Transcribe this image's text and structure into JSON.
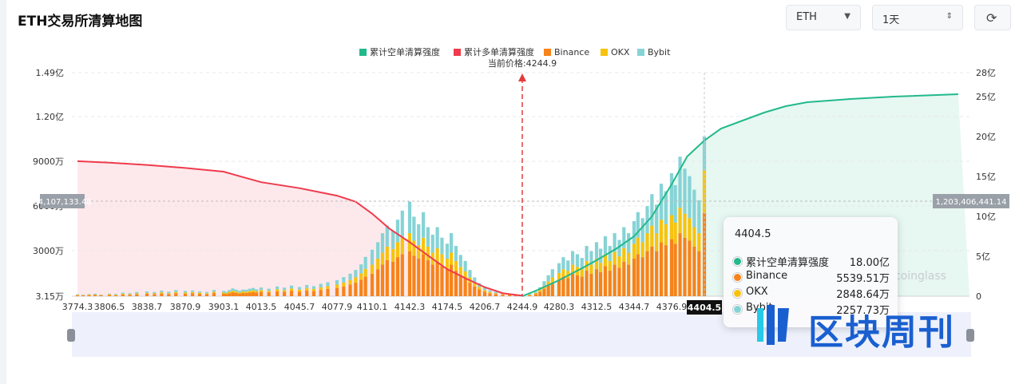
{
  "page": {
    "title": "ETH交易所清算地图",
    "coin_select": "ETH",
    "range_select": "1天",
    "refresh_icon": "refresh-icon"
  },
  "colors": {
    "short_cum": "#22b98b",
    "long_cum": "#ef3b4c",
    "binance": "#f7831a",
    "okx": "#f7c30e",
    "bybit": "#86d3d6",
    "price_marker": "#e23b3b",
    "short_area": "#e4f6ef",
    "long_area": "#fde7ea"
  },
  "chart_data": {
    "type": "bar",
    "title": "",
    "legend": [
      {
        "name": "累计空单清算强度",
        "color": "#22b98b"
      },
      {
        "name": "累计多单清算强度",
        "color": "#ef3b4c"
      },
      {
        "name": "Binance",
        "color": "#f7831a"
      },
      {
        "name": "OKX",
        "color": "#f7c30e"
      },
      {
        "name": "Bybit",
        "color": "#86d3d6"
      }
    ],
    "legend_position": "top-center",
    "current_price_label": "当前价格:4244.9",
    "current_price": 4244.9,
    "x_ticks": [
      "3774.3",
      "3806.5",
      "3838.7",
      "3870.9",
      "3903.1",
      "4013.5",
      "4045.7",
      "4077.9",
      "4110.1",
      "4142.3",
      "4174.5",
      "4206.7",
      "4244.9",
      "4280.3",
      "4312.5",
      "4344.7",
      "4376.9",
      "4404.5"
    ],
    "x_range": [
      3774.3,
      4450
    ],
    "y_left_ticks": [
      "3.15万",
      "3000万",
      "6000万",
      "9000万",
      "1.20亿",
      "1.49亿"
    ],
    "y_left_range_label": [
      "3.15万",
      "1.49亿"
    ],
    "y_right_ticks": [
      "0",
      "5亿",
      "10亿",
      "15亿",
      "20亿",
      "25亿",
      "28亿"
    ],
    "y_right_range": [
      0,
      28
    ],
    "left_axis_pointer": "64,107,133.46",
    "right_axis_pointer": "1,203,406,441.14",
    "hover_x": "4404.5",
    "long_cum_curve": {
      "name": "累计多单清算强度",
      "x": [
        3774.3,
        3806.5,
        3838.7,
        3870.9,
        3903.1,
        3950,
        4013.5,
        4045.7,
        4077.9,
        4095,
        4110.1,
        4125,
        4142.3,
        4160,
        4174.5,
        4190,
        4206.7,
        4225,
        4244.9
      ],
      "y_wan": [
        9000,
        8900,
        8750,
        8550,
        8300,
        8000,
        7600,
        7200,
        6700,
        6300,
        5500,
        4500,
        3600,
        2600,
        1800,
        1200,
        600,
        200,
        31.5
      ]
    },
    "short_cum_curve": {
      "name": "累计空单清算强度",
      "x": [
        4244.9,
        4260,
        4280.3,
        4300,
        4312.5,
        4330,
        4344.7,
        4360,
        4376.9,
        4390,
        4404.5,
        4420,
        4440,
        4460,
        4480,
        4500,
        4540,
        4580,
        4640
      ],
      "y_yi": [
        0,
        0.8,
        2,
        3.5,
        4.5,
        6,
        7.5,
        10,
        14,
        17.5,
        19.5,
        21,
        22,
        23,
        23.8,
        24.3,
        24.7,
        25,
        25.3
      ]
    },
    "bar_series": [
      {
        "name": "Binance",
        "note": "stacked bottom"
      },
      {
        "name": "OKX",
        "note": "stacked middle"
      },
      {
        "name": "Bybit",
        "note": "stacked top"
      }
    ],
    "bars": [
      [
        3774.3,
        60,
        30,
        40
      ],
      [
        3780,
        50,
        20,
        30
      ],
      [
        3786,
        70,
        40,
        30
      ],
      [
        3792,
        80,
        30,
        60
      ],
      [
        3798,
        60,
        20,
        30
      ],
      [
        3806.5,
        90,
        40,
        40
      ],
      [
        3812,
        70,
        30,
        50
      ],
      [
        3818,
        110,
        50,
        80
      ],
      [
        3824,
        100,
        40,
        60
      ],
      [
        3830,
        130,
        60,
        90
      ],
      [
        3838.7,
        160,
        60,
        100
      ],
      [
        3845,
        140,
        50,
        90
      ],
      [
        3851,
        180,
        80,
        110
      ],
      [
        3857,
        150,
        50,
        100
      ],
      [
        3863,
        200,
        80,
        130
      ],
      [
        3870.9,
        170,
        70,
        110
      ],
      [
        3877,
        190,
        90,
        100
      ],
      [
        3883,
        160,
        70,
        90
      ],
      [
        3889,
        140,
        60,
        80
      ],
      [
        3895,
        210,
        80,
        120
      ],
      [
        3903.1,
        180,
        70,
        100
      ],
      [
        3910,
        150,
        50,
        90
      ],
      [
        3920,
        200,
        90,
        120
      ],
      [
        3930,
        260,
        110,
        150
      ],
      [
        3940,
        230,
        80,
        130
      ],
      [
        3950,
        180,
        70,
        110
      ],
      [
        3960,
        220,
        100,
        120
      ],
      [
        3970,
        210,
        90,
        130
      ],
      [
        3980,
        250,
        100,
        150
      ],
      [
        3990,
        270,
        120,
        160
      ],
      [
        4000,
        240,
        90,
        130
      ],
      [
        4013.5,
        300,
        110,
        170
      ],
      [
        4020,
        260,
        100,
        140
      ],
      [
        4027,
        330,
        140,
        180
      ],
      [
        4033,
        290,
        120,
        160
      ],
      [
        4039,
        360,
        150,
        200
      ],
      [
        4045.7,
        310,
        130,
        170
      ],
      [
        4052,
        380,
        160,
        210
      ],
      [
        4058,
        340,
        140,
        190
      ],
      [
        4064,
        420,
        170,
        230
      ],
      [
        4070,
        480,
        190,
        260
      ],
      [
        4077.9,
        550,
        220,
        300
      ],
      [
        4084,
        650,
        260,
        360
      ],
      [
        4090,
        780,
        300,
        420
      ],
      [
        4095,
        900,
        350,
        500
      ],
      [
        4100,
        1100,
        420,
        600
      ],
      [
        4104,
        1300,
        520,
        800
      ],
      [
        4110.1,
        1500,
        600,
        1000
      ],
      [
        4115,
        1800,
        700,
        1100
      ],
      [
        4119,
        2100,
        800,
        1300
      ],
      [
        4123,
        2400,
        900,
        1400
      ],
      [
        4128,
        2300,
        850,
        1200
      ],
      [
        4132,
        2600,
        1000,
        1500
      ],
      [
        4136,
        2800,
        1100,
        1800
      ],
      [
        4142.3,
        3000,
        1200,
        2100
      ],
      [
        4146,
        2700,
        1000,
        1600
      ],
      [
        4150,
        2500,
        900,
        1400
      ],
      [
        4154,
        2800,
        1100,
        1700
      ],
      [
        4158,
        2400,
        900,
        1300
      ],
      [
        4162,
        2100,
        800,
        1200
      ],
      [
        4166,
        2300,
        900,
        1400
      ],
      [
        4170,
        2000,
        800,
        1100
      ],
      [
        4174.5,
        1800,
        700,
        1000
      ],
      [
        4178,
        2100,
        800,
        1300
      ],
      [
        4182,
        1700,
        650,
        1000
      ],
      [
        4186,
        1400,
        550,
        800
      ],
      [
        4190,
        1200,
        450,
        700
      ],
      [
        4194,
        900,
        350,
        500
      ],
      [
        4198,
        650,
        250,
        350
      ],
      [
        4202,
        450,
        170,
        250
      ],
      [
        4206.7,
        300,
        110,
        170
      ],
      [
        4212,
        200,
        80,
        110
      ],
      [
        4218,
        150,
        50,
        90
      ],
      [
        4225,
        100,
        40,
        60
      ],
      [
        4232,
        80,
        30,
        50
      ],
      [
        4238,
        60,
        20,
        40
      ],
      [
        4252,
        70,
        30,
        50
      ],
      [
        4258,
        150,
        60,
        90
      ],
      [
        4262,
        300,
        120,
        180
      ],
      [
        4266,
        500,
        200,
        300
      ],
      [
        4270,
        700,
        280,
        420
      ],
      [
        4274,
        900,
        350,
        550
      ],
      [
        4280.3,
        1100,
        450,
        650
      ],
      [
        4284,
        1300,
        500,
        800
      ],
      [
        4288,
        1200,
        480,
        700
      ],
      [
        4292,
        1500,
        600,
        900
      ],
      [
        4296,
        1400,
        550,
        850
      ],
      [
        4300,
        1300,
        500,
        750
      ],
      [
        4304,
        1700,
        650,
        1000
      ],
      [
        4308,
        1500,
        600,
        900
      ],
      [
        4312.5,
        1800,
        700,
        1100
      ],
      [
        4316,
        1600,
        620,
        950
      ],
      [
        4320,
        2000,
        800,
        1200
      ],
      [
        4324,
        1700,
        650,
        1000
      ],
      [
        4328,
        2100,
        850,
        1250
      ],
      [
        4332,
        1900,
        750,
        1100
      ],
      [
        4336,
        2300,
        900,
        1400
      ],
      [
        4340,
        2100,
        800,
        1300
      ],
      [
        4344.7,
        2500,
        1000,
        1500
      ],
      [
        4348,
        2800,
        1100,
        1700
      ],
      [
        4352,
        2600,
        1000,
        1600
      ],
      [
        4356,
        3000,
        1200,
        1800
      ],
      [
        4360,
        3300,
        1400,
        2100
      ],
      [
        4364,
        3000,
        1200,
        1900
      ],
      [
        4368,
        3600,
        1500,
        2400
      ],
      [
        4372,
        3400,
        1400,
        2200
      ],
      [
        4376.9,
        3800,
        1600,
        2800
      ],
      [
        4380,
        3500,
        1400,
        2500
      ],
      [
        4384,
        4200,
        1700,
        3400
      ],
      [
        4388,
        3900,
        1600,
        3000
      ],
      [
        4392,
        3700,
        1500,
        2800
      ],
      [
        4396,
        3300,
        1300,
        2500
      ],
      [
        4400,
        3000,
        1200,
        2200
      ],
      [
        4404.5,
        5539.51,
        2848.64,
        2257.73
      ]
    ],
    "tooltip": {
      "title": "4404.5",
      "rows": [
        {
          "name": "累计空单清算强度",
          "value": "18.00亿",
          "color": "#22b98b"
        },
        {
          "name": "Binance",
          "value": "5539.51万",
          "color": "#f7831a"
        },
        {
          "name": "OKX",
          "value": "2848.64万",
          "color": "#f7c30e"
        },
        {
          "name": "Bybit",
          "value": "2257.73万",
          "color": "#86d3d6"
        }
      ]
    },
    "watermarks": [
      "coinglass",
      "区块周刊"
    ]
  }
}
